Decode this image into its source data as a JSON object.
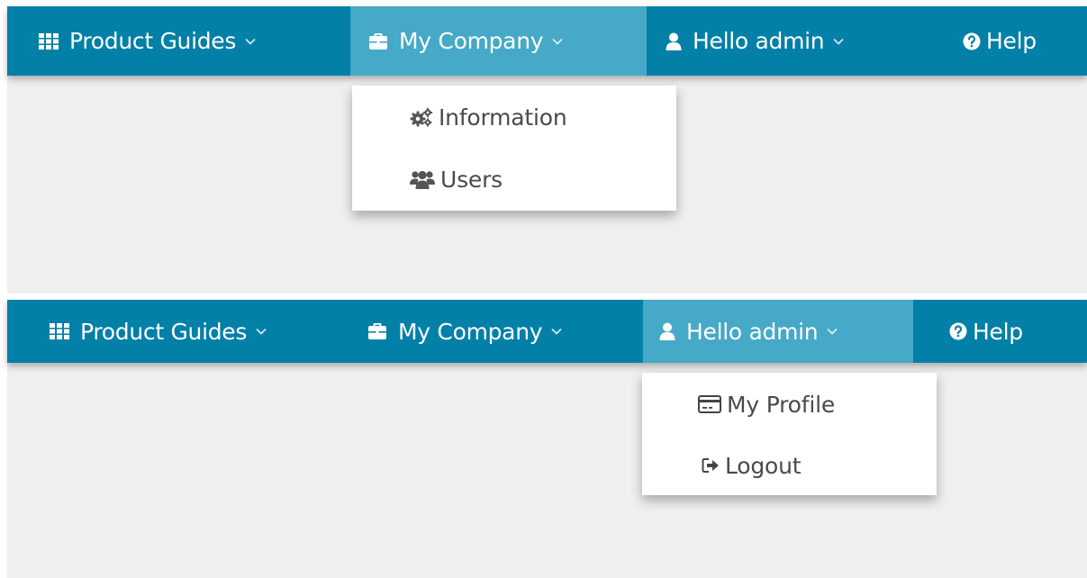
{
  "top": {
    "nav": {
      "product_guides": "Product Guides",
      "my_company": "My Company",
      "hello_admin": "Hello admin",
      "help": "Help"
    },
    "dropdown": {
      "items": [
        {
          "label": "Information",
          "icon": "cogs-icon"
        },
        {
          "label": "Users",
          "icon": "users-icon"
        }
      ]
    }
  },
  "bottom": {
    "nav": {
      "product_guides": "Product Guides",
      "my_company": "My Company",
      "hello_admin": "Hello admin",
      "help": "Help"
    },
    "dropdown": {
      "items": [
        {
          "label": "My Profile",
          "icon": "id-card-icon"
        },
        {
          "label": "Logout",
          "icon": "sign-out-icon"
        }
      ]
    }
  },
  "colors": {
    "navbar": "#0380a8",
    "active_item": "#45a9c7",
    "background": "#efefef",
    "dropdown_text": "#4a4a4a"
  }
}
